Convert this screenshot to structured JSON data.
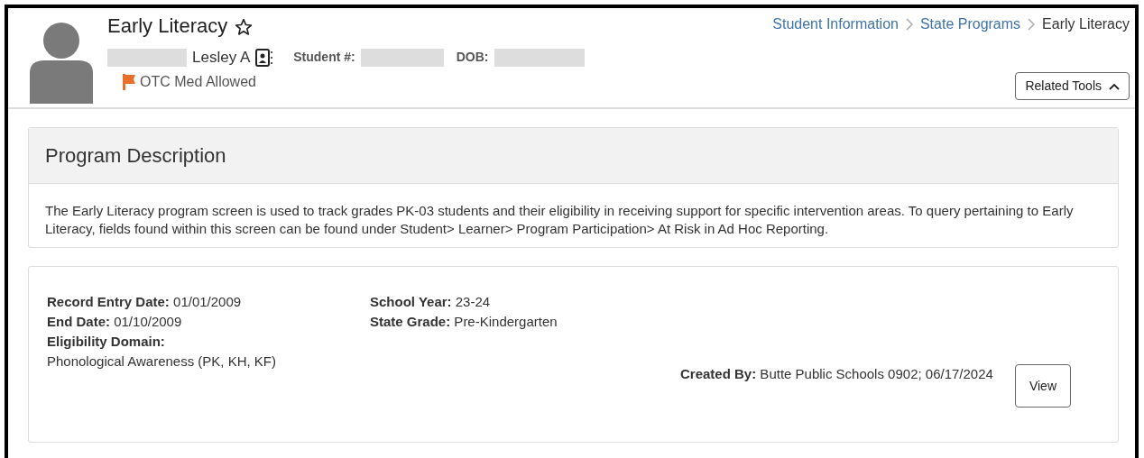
{
  "header": {
    "title": "Early Literacy",
    "favorite": false,
    "student_name": "Lesley A",
    "student_number_label": "Student #:",
    "dob_label": "DOB:",
    "flag_text": "OTC Med Allowed"
  },
  "breadcrumbs": [
    {
      "label": "Student Information",
      "link": true
    },
    {
      "label": "State Programs",
      "link": true
    },
    {
      "label": "Early Literacy",
      "link": false
    }
  ],
  "related_tools": {
    "label": "Related Tools",
    "expanded": true
  },
  "program_description": {
    "title": "Program Description",
    "text": "The Early Literacy program screen is used to track grades PK-03 students and their eligibility in receiving support for specific intervention areas. To query pertaining to Early Literacy, fields found within this screen can be found under Student> Learner> Program Participation> At Risk in Ad Hoc Reporting."
  },
  "record": {
    "left_fields": [
      "**Record Entry Date:** 01/01/2009",
      "**End Date:** 01/10/2009"
    ],
    "right_fields": [
      "**School Year:** 23-24",
      "**State Grade:** Pre-Kindergarten"
    ],
    "domain_label": "Eligibility Domain:",
    "domain_value": "Phonological Awareness (PK, KH, KF)",
    "created_by": "**Created By:** Butte Public Schools 0902; 06/17/2024",
    "view_button": "View"
  }
}
